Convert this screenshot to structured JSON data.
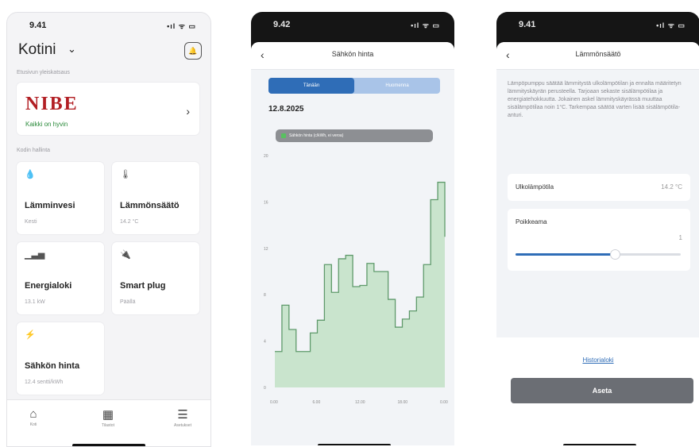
{
  "phone_home": {
    "status": {
      "time": "9.41",
      "indicators": "•ıl ᯤ ▭"
    },
    "header": {
      "title": "Kotini"
    },
    "section_devices": "Etusivun yleiskatsaus",
    "device": {
      "brand": "NIBE",
      "status": "Kaikki on hyvin"
    },
    "section_controls": "Kodin hallinta",
    "tiles": [
      {
        "name": "Lämminvesi",
        "value": "Kesti",
        "icon": "water-drop-icon"
      },
      {
        "name": "Lämmönsäätö",
        "value": "14.2 °C",
        "icon": "thermometer-icon"
      },
      {
        "name": "Energialoki",
        "value": "13.1 kW",
        "icon": "bar-chart-icon"
      },
      {
        "name": "Smart plug",
        "value": "Päällä",
        "icon": "plug-icon"
      },
      {
        "name": "Sähkön hinta",
        "value": "12.4 sentti/kWh",
        "icon": "lightning-icon"
      }
    ],
    "tabbar": [
      {
        "label": "Koti",
        "icon": "home-icon"
      },
      {
        "label": "Tilastot",
        "icon": "calendar-icon"
      },
      {
        "label": "Asetukset",
        "icon": "settings-sliders-icon"
      }
    ]
  },
  "phone_price": {
    "status": {
      "time": "9.42",
      "indicators": "•ıl ᯤ ▭"
    },
    "nav": {
      "title": "Sähkön hinta"
    },
    "segments": [
      "Tänään",
      "Huomenna"
    ],
    "date": "12.8.2025",
    "legend": "Sähkön hinta (c/kWh, ei veroa)",
    "colors": {
      "fill": "#c9e4cd",
      "line": "#5f9a6b"
    }
  },
  "phone_heat": {
    "status": {
      "time": "9.41",
      "indicators": "•ıl ᯤ ▭"
    },
    "nav": {
      "title": "Lämmönsäätö"
    },
    "description": "Lämpöpumppu säätää lämmitystä ulkolämpötilan ja ennalta määritetyn lämmityskäyrän perusteella. Tarjoaan sekaste sisälämpötilaa ja energiatehokkuutta. Jokainen askel lämmityskäyrässä muuttaa sisälämpötilaa noin 1°C. Tarkempaa säätöä varten lisää sisälämpötila-anturi.",
    "outdoor": {
      "label": "Ulkolämpötila",
      "value": "14.2 °C"
    },
    "offset": {
      "label": "Poikkeama",
      "value": "1",
      "level_fraction": 0.6
    },
    "history_link": "Historialoki",
    "set_button": "Aseta"
  },
  "chart_data": {
    "type": "line",
    "step": true,
    "x": [
      0,
      1,
      2,
      3,
      4,
      5,
      6,
      7,
      8,
      9,
      10,
      11,
      12,
      13,
      14,
      15,
      16,
      17,
      18,
      19,
      20,
      21,
      22,
      23,
      24
    ],
    "values": [
      3.1,
      7.1,
      5.0,
      3.1,
      3.1,
      4.7,
      5.8,
      10.6,
      8.2,
      11.1,
      11.4,
      8.7,
      8.8,
      10.7,
      10.0,
      10.0,
      7.6,
      5.2,
      5.9,
      6.6,
      7.8,
      10.6,
      16.2,
      17.7,
      13.0
    ],
    "ytick_labels": [
      "0",
      "4",
      "8",
      "12",
      "16",
      "20"
    ],
    "xtick_labels": [
      "0.00",
      "6.00",
      "12.00",
      "18.00",
      "0.00"
    ],
    "ylim": [
      0,
      20
    ],
    "grid": false
  }
}
